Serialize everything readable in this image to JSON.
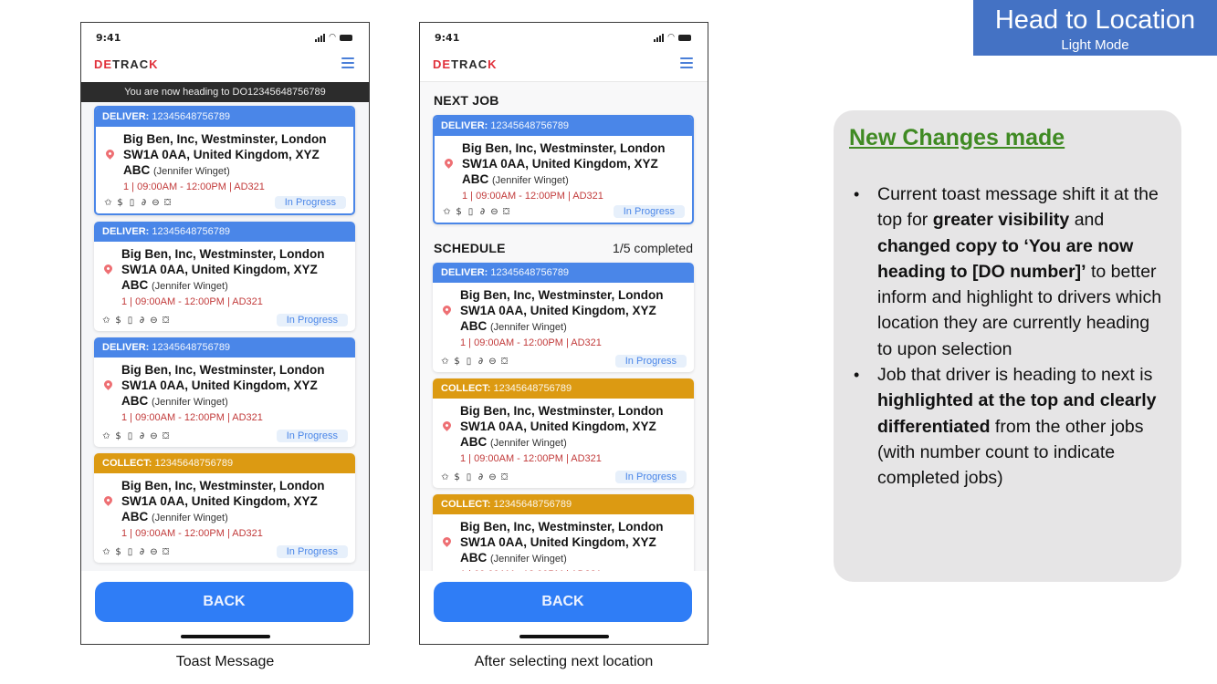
{
  "banner": {
    "title": "Head to Location",
    "subtitle": "Light Mode"
  },
  "phones": {
    "common": {
      "time": "9:41",
      "logo": {
        "part1": "DE",
        "part2": "TRAC",
        "part3": "K"
      },
      "back_label": "BACK",
      "job": {
        "address_line1": "Big Ben, Inc, Westminster, London",
        "address_line2": "SW1A 0AA, United Kingdom, XYZ",
        "address_line3": "ABC",
        "contact": "(Jennifer Winget)",
        "meta": "1 | 09:00AM - 12:00PM | AD321",
        "status": "In Progress",
        "id": "12345648756789",
        "icons": [
          "pin-icon",
          "dollar-icon",
          "phone-icon",
          "attachment-icon",
          "chat-icon",
          "package-icon"
        ]
      },
      "type_labels": {
        "deliver": "DELIVER:",
        "collect": "COLLECT:"
      }
    },
    "left": {
      "caption": "Toast Message",
      "toast": "You are now heading to DO12345648756789",
      "jobs": [
        "deliver",
        "deliver",
        "deliver",
        "collect"
      ]
    },
    "right": {
      "caption": "After selecting next location",
      "next_job_title": "NEXT JOB",
      "schedule_title": "SCHEDULE",
      "schedule_count": "1/5 completed",
      "next_job": "deliver",
      "schedule_jobs": [
        "deliver",
        "collect",
        "collect"
      ]
    }
  },
  "changes": {
    "title": "New Changes made",
    "items": [
      [
        {
          "t": "Current toast message shift it at the top for ",
          "b": false
        },
        {
          "t": "greater visibility",
          "b": true
        },
        {
          "t": " and ",
          "b": false
        },
        {
          "t": "changed copy to ‘You are now heading to [DO number]’",
          "b": true
        },
        {
          "t": " to better inform and highlight to drivers which location they are currently heading to upon selection",
          "b": false
        }
      ],
      [
        {
          "t": "Job that driver is heading to next is ",
          "b": false
        },
        {
          "t": "highlighted at the top and clearly differentiated",
          "b": true
        },
        {
          "t": " from the other jobs (with number count to indicate completed jobs)",
          "b": false
        }
      ]
    ]
  },
  "colors": {
    "deliver": "#4a86e8",
    "collect": "#dc9a12",
    "primary_button": "#2f7df6",
    "toast_bg": "#2c2c2c",
    "heading_green": "#3f8a23",
    "banner": "#4472c4"
  }
}
